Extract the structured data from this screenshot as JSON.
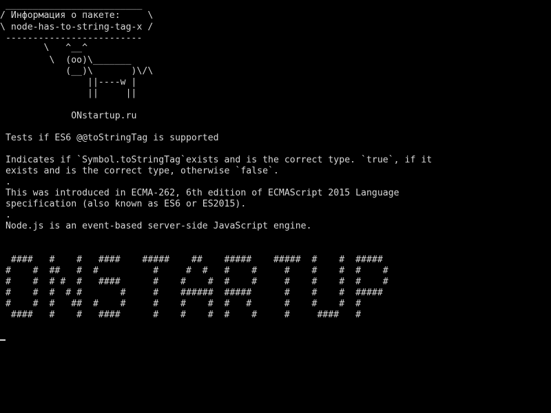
{
  "terminal": {
    "cowsay": [
      " _________________________",
      "/ Информация о пакете:     \\",
      "\\ node-has-to-string-tag-x /",
      " -------------------------",
      "        \\   ^__^",
      "         \\  (oo)\\_______",
      "            (__)\\       )\\/\\",
      "                ||----w |",
      "                ||     ||"
    ],
    "site": "             ONstartup.ru",
    "description": [
      " Tests if ES6 @@toStringTag is supported",
      "",
      " Indicates if `Symbol.toStringTag`exists and is the correct type. `true`, if it",
      " exists and is the correct type, otherwise `false`.",
      " .",
      " This was introduced in ECMA-262, 6th edition of ECMAScript 2015 Language",
      " specification (also known as ES6 or ES2015).",
      " .",
      " Node.js is an event-based server-side JavaScript engine."
    ],
    "banner": [
      "  ####   #    #   ####    #####    ##    #####    #####  #    #  #####",
      " #    #  ##   #  #          #     #  #   #    #     #    #    #  #    #",
      " #    #  # #  #   ####      #    #    #  #    #     #    #    #  #    #",
      " #    #  #  # #       #     #    ######  #####      #    #    #  #####",
      " #    #  #   ##  #    #     #    #    #  #   #      #    #    #  #",
      "  ####   #    #   ####      #    #    #  #    #     #     ####   #"
    ]
  }
}
